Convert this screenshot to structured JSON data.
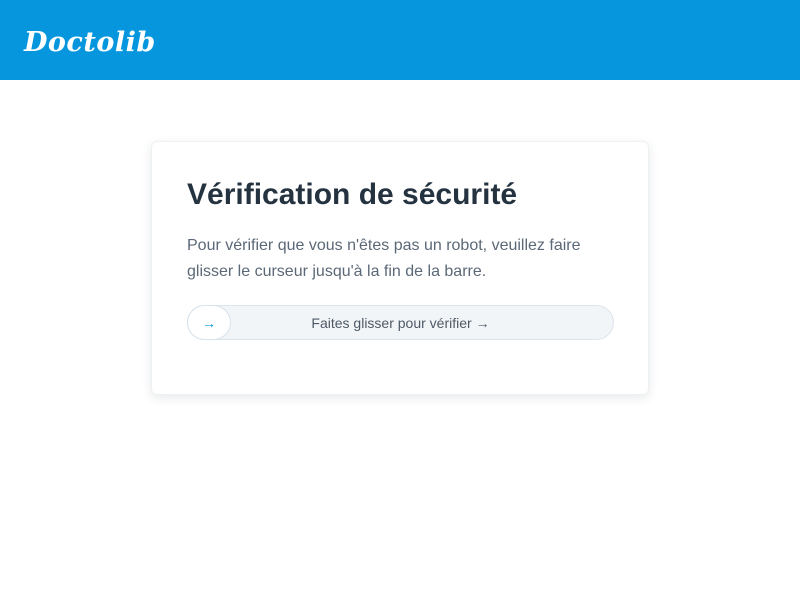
{
  "header": {
    "logo_text": "Doctolib",
    "background_color": "#0596de"
  },
  "card": {
    "title": "Vérification de sécurité",
    "description": "Pour vérifier que vous n'êtes pas un robot, veuillez faire glisser le curseur jusqu'à la fin de la barre.",
    "slider": {
      "label": "Faites glisser pour vérifier →",
      "handle_icon": "→",
      "handle_icon_name": "arrow-right-icon",
      "progress": 0
    }
  }
}
